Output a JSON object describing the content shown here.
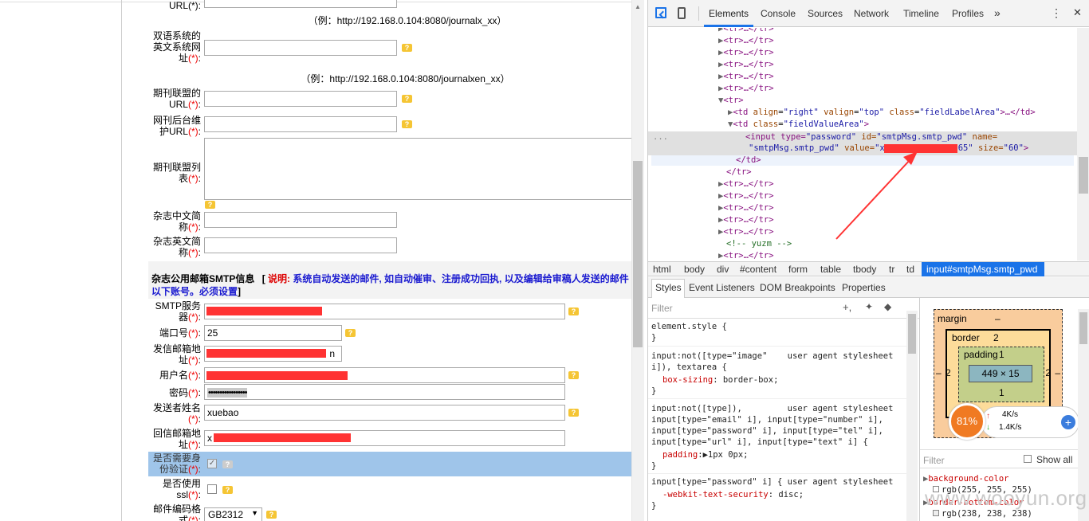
{
  "form": {
    "row_url_top": {
      "label": "URL(*):"
    },
    "example1": "（例：http://192.168.0.104:8080/journalx_xx）",
    "en_url": {
      "label1": "双语系统的",
      "label2": "英文系统网",
      "label3": "址",
      "req": "(*)",
      "colon": ":"
    },
    "example2": "（例：http://192.168.0.104:8080/journalxen_xx）",
    "alliance_url": {
      "label1": "期刊联盟的",
      "label2": "URL",
      "req": "(*)",
      "colon": ":"
    },
    "backend_url": {
      "label1": "网刊后台维",
      "label2": "护URL",
      "req": "(*)",
      "colon": ":"
    },
    "alliance_list": {
      "label1": "期刊联盟列",
      "label2": "表",
      "req": "(*)",
      "colon": ":"
    },
    "cn_abbr": {
      "label1": "杂志中文简",
      "label2": "称",
      "req": "(*)",
      "colon": ":"
    },
    "en_abbr": {
      "label1": "杂志英文简",
      "label2": "称",
      "req": "(*)",
      "colon": ":"
    },
    "smtp_section": {
      "title": "杂志公用邮箱SMTP信息",
      "bracket_open": "[",
      "note_label": "说明:",
      "note_text": "系统自动发送的邮件, 如自动催审、注册成功回执, 以及编辑给审稿人发送的邮件",
      "note_line2": "以下账号。必须设置",
      "bracket_close": "]"
    },
    "smtp_server": {
      "label1": "SMTP服务",
      "label2": "器",
      "req": "(*)",
      "colon": ":"
    },
    "port": {
      "label": "端口号",
      "req": "(*)",
      "colon": ":",
      "value": "25"
    },
    "sender_email": {
      "label1": "发信邮箱地",
      "label2": "址",
      "req": "(*)",
      "colon": ":",
      "visible_suffix": "n"
    },
    "username": {
      "label": "用户名",
      "req": "(*)",
      "colon": ":"
    },
    "password": {
      "label": "密码",
      "req": "(*)",
      "colon": ":",
      "value": "•••••••••••••••••"
    },
    "sender_name": {
      "label1": "发送者姓名",
      "req": "(*)",
      "colon": ":",
      "value": "xuebao"
    },
    "reply_email": {
      "label1": "回信邮箱地",
      "label2": "址",
      "req": "(*)",
      "colon": ":",
      "value": "x"
    },
    "need_auth": {
      "label1": "是否需要身",
      "label2": "份验证",
      "req": "(*)",
      "colon": ":"
    },
    "use_ssl": {
      "label1": "是否使用",
      "label2": "ssl",
      "req": "(*)",
      "colon": ":"
    },
    "encoding": {
      "label1": "邮件编码格",
      "label2": "式",
      "req": "(*)",
      "colon": ":",
      "value": "GB2312"
    }
  },
  "devtools": {
    "tabs": [
      "Elements",
      "Console",
      "Sources",
      "Network",
      "Timeline",
      "Profiles"
    ],
    "more": "»",
    "menu": "⋮",
    "close": "✕",
    "tree": {
      "tr_collapsed": "<tr>…</tr>",
      "tr_open": "<tr>",
      "td_label": "<td align=\"right\" valign=\"top\" class=\"fieldLabelArea\">…</td>",
      "td_value_open": "<td class=\"fieldValueArea\">",
      "input_line1_tag": "<input type=",
      "input_line1_type": "\"password\"",
      "input_line1_id_attr": " id=",
      "input_line1_id": "\"smtpMsg.smtp_pwd\"",
      "input_line1_name_attr": " name=",
      "input_line2_name": "\"smtpMsg.smtp_pwd\"",
      "input_line2_value_attr": " value=",
      "input_line2_value_start": "\"x",
      "input_line2_value_end": "65\"",
      "input_line2_size_attr": " size=",
      "input_line2_size": "\"60\"",
      "input_line2_close": ">",
      "td_close": "</td>",
      "tr_close": "</tr>",
      "comment": "<!-- yuzm -->",
      "ellipsis": "..."
    },
    "breadcrumb": [
      "html",
      "body",
      "div",
      "#content",
      "form",
      "table",
      "tbody",
      "tr",
      "td",
      "input#smtpMsg.smtp_pwd"
    ],
    "subtabs": [
      "Styles",
      "Event Listeners",
      "DOM Breakpoints",
      "Properties"
    ],
    "filter_placeholder": "Filter",
    "styles": {
      "r1_sel": "element.style {",
      "r1_end": "}",
      "r2_sel": "input:not([type=\"image\"    user agent stylesheet",
      "r2_sel2": "i]), textarea {",
      "r2_prop": "box-sizing",
      "r2_val": ": border-box;",
      "r2_end": "}",
      "r3_sel": "input:not([type]),         user agent stylesheet",
      "r3_sel2": "input[type=\"email\" i], input[type=\"number\" i],",
      "r3_sel3": "input[type=\"password\" i], input[type=\"tel\" i],",
      "r3_sel4": "input[type=\"url\" i], input[type=\"text\" i] {",
      "r3_prop": "padding",
      "r3_val": ":▶1px 0px;",
      "r3_end": "}",
      "r4_sel": "input[type=\"password\" i] { user agent stylesheet",
      "r4_prop": "-webkit-text-security",
      "r4_val": ": disc;",
      "r4_end": "}"
    },
    "boxmodel": {
      "margin": "margin",
      "margin_val": "–",
      "border": "border",
      "border_val": "2",
      "padding": "padding",
      "padding_val": "1",
      "content": "449 × 15",
      "left": "2",
      "right": "2",
      "bottom_pad": "1",
      "outer_left": "–",
      "outer_right": "–"
    },
    "computed_filter": "Filter",
    "show_all": "Show all",
    "computed": [
      {
        "prop": "background-color",
        "val": "rgb(255, 255, 255)"
      },
      {
        "prop": "border-bottom-color",
        "val": "rgb(238, 238, 238)"
      }
    ],
    "net_widget": {
      "percent": "81%",
      "up": "4K/s",
      "down": "1.4K/s"
    }
  },
  "watermark": "www.wooyun.org",
  "colors": {
    "accent": "#1a73e8",
    "required": "#e00000",
    "redact": "#ff3333",
    "selected_row": "#9fc5ea"
  }
}
